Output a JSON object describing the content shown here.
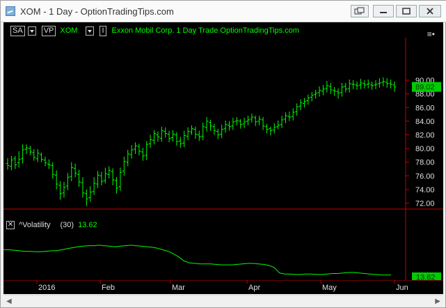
{
  "window": {
    "title": "XOM - 1 Day - OptionTradingTips.com"
  },
  "toolbar": {
    "sa_label": "SA",
    "vp_label": "VP",
    "symbol": "XOM",
    "i_label": "I",
    "description": "Exxon Mobil Corp.  1 Day  Trade  OptionTradingTips.com"
  },
  "indicator": {
    "name": "^Volatility",
    "period": "(30)",
    "value": "13.62"
  },
  "colors": {
    "bars": "#00ff00",
    "price_badge": "#00cc00",
    "volatility_line": "#00ff00",
    "axis_line": "#cc0000",
    "background": "#000000"
  },
  "chart_data": [
    {
      "type": "ohlc",
      "yticks": [
        "72.00",
        "74.00",
        "76.00",
        "78.00",
        "80.00",
        "82.00",
        "84.00",
        "86.00",
        "88.00",
        "90.00"
      ],
      "ylim": [
        70.5,
        91.0
      ],
      "last_price": "89.02",
      "xticks": [
        "2016",
        "Feb",
        "Mar",
        "Apr",
        "May",
        "Jun"
      ],
      "closes": [
        77.5,
        78.3,
        77.6,
        78.4,
        79.8,
        80.1,
        79.5,
        78.7,
        79.3,
        78.4,
        77.9,
        77.6,
        76.2,
        74.8,
        73.4,
        74.3,
        75.8,
        77.2,
        76.4,
        75.1,
        73.5,
        72.6,
        73.6,
        74.9,
        76.1,
        75.2,
        76.3,
        76.8,
        75.4,
        74.2,
        76.5,
        78.1,
        79.2,
        79.8,
        80.4,
        79.6,
        78.9,
        80.6,
        81.3,
        82.2,
        81.7,
        82.6,
        82.2,
        81.5,
        82.1,
        81.0,
        80.7,
        81.9,
        82.5,
        82.9,
        82.1,
        81.7,
        83.2,
        84.0,
        83.3,
        82.6,
        82.0,
        82.8,
        83.5,
        83.2,
        83.9,
        84.1,
        83.5,
        83.9,
        84.2,
        84.6,
        83.9,
        84.3,
        83.3,
        82.8,
        82.6,
        83.1,
        83.4,
        84.2,
        84.8,
        84.6,
        85.3,
        86.1,
        86.7,
        86.9,
        87.4,
        87.8,
        88.1,
        88.5,
        88.7,
        89.2,
        88.6,
        88.4,
        88.1,
        89.0,
        88.7,
        89.5,
        89.4,
        89.2,
        89.6,
        89.3,
        89.5,
        89.2,
        89.4,
        89.6,
        89.8,
        89.5,
        89.4,
        89.0
      ],
      "opens": [
        77.8,
        77.4,
        78.5,
        77.9,
        78.5,
        79.9,
        80.0,
        79.4,
        78.5,
        79.1,
        78.3,
        77.7,
        77.5,
        76.1,
        74.6,
        73.5,
        74.5,
        75.9,
        77.1,
        76.2,
        75.0,
        73.4,
        72.8,
        73.7,
        74.8,
        76.0,
        75.3,
        76.2,
        76.6,
        75.3,
        74.4,
        76.7,
        78.0,
        79.1,
        79.9,
        80.3,
        79.5,
        79.0,
        80.7,
        81.2,
        82.0,
        81.5,
        82.5,
        82.1,
        81.6,
        82.0,
        81.1,
        80.8,
        81.8,
        82.4,
        82.8,
        82.0,
        81.8,
        83.1,
        83.8,
        83.2,
        82.5,
        82.1,
        82.9,
        83.4,
        83.3,
        84.0,
        84.0,
        83.6,
        84.0,
        84.3,
        84.5,
        84.0,
        84.2,
        83.2,
        82.9,
        82.7,
        83.2,
        83.5,
        84.3,
        84.7,
        84.7,
        85.4,
        86.2,
        86.6,
        87.0,
        87.5,
        87.9,
        88.2,
        88.4,
        88.8,
        89.1,
        88.5,
        88.3,
        88.2,
        89.1,
        88.8,
        89.4,
        89.3,
        89.3,
        89.5,
        89.4,
        89.3,
        89.3,
        89.5,
        89.7,
        89.7,
        89.5,
        89.3
      ],
      "highs": [
        78.6,
        78.9,
        78.9,
        79.6,
        80.6,
        80.6,
        80.4,
        79.9,
        79.9,
        79.4,
        78.8,
        78.4,
        78.0,
        76.8,
        75.2,
        75.1,
        76.4,
        78.0,
        77.8,
        76.9,
        75.8,
        74.0,
        74.5,
        75.8,
        76.7,
        76.6,
        77.2,
        77.4,
        77.1,
        75.8,
        77.2,
        78.8,
        79.8,
        80.5,
        80.9,
        80.7,
        80.1,
        81.1,
        82.0,
        82.7,
        82.5,
        83.2,
        83.1,
        82.6,
        82.7,
        82.4,
        81.7,
        82.6,
        83.1,
        83.4,
        83.2,
        82.6,
        83.8,
        84.6,
        84.2,
        83.6,
        82.9,
        83.5,
        84.1,
        84.0,
        84.5,
        84.6,
        84.3,
        84.5,
        84.8,
        85.1,
        84.8,
        84.8,
        84.6,
        83.6,
        83.2,
        83.7,
        84.1,
        84.8,
        85.3,
        85.4,
        85.9,
        86.6,
        87.2,
        87.4,
        87.9,
        88.3,
        88.6,
        89.1,
        89.3,
        89.9,
        89.6,
        89.0,
        88.8,
        89.6,
        89.6,
        90.1,
        90.0,
        89.8,
        90.2,
        90.0,
        90.1,
        89.8,
        90.0,
        90.3,
        90.4,
        90.3,
        90.1,
        89.8
      ],
      "lows": [
        76.9,
        76.8,
        77.0,
        77.2,
        77.8,
        79.2,
        79.0,
        78.2,
        78.0,
        78.0,
        77.4,
        77.0,
        75.6,
        74.0,
        72.5,
        72.8,
        73.9,
        75.2,
        75.8,
        74.4,
        72.8,
        71.6,
        72.2,
        73.2,
        74.2,
        74.6,
        74.9,
        75.6,
        74.6,
        73.4,
        73.8,
        76.0,
        77.4,
        78.5,
        79.2,
        79.0,
        78.2,
        78.3,
        80.1,
        80.6,
        81.0,
        81.0,
        81.6,
        80.9,
        81.0,
        80.4,
        80.1,
        80.2,
        81.2,
        82.0,
        81.4,
        81.1,
        81.2,
        82.5,
        82.6,
        82.0,
        81.4,
        81.5,
        82.3,
        82.6,
        82.7,
        83.4,
        82.9,
        83.0,
        83.4,
        83.8,
        83.3,
        83.4,
        82.7,
        82.2,
        81.9,
        82.2,
        82.8,
        83.0,
        83.7,
        84.0,
        84.1,
        84.8,
        85.6,
        86.0,
        86.4,
        86.9,
        87.3,
        87.6,
        87.8,
        88.2,
        88.0,
        87.7,
        87.3,
        87.6,
        88.2,
        88.2,
        88.7,
        88.6,
        88.7,
        88.8,
        88.8,
        88.6,
        88.7,
        88.9,
        89.1,
        88.9,
        88.8,
        88.3
      ]
    },
    {
      "type": "line",
      "name": "^Volatility",
      "values": [
        28,
        28,
        27.5,
        27,
        26.5,
        26.5,
        26,
        26,
        26.5,
        27,
        27,
        28,
        29,
        30,
        31,
        31.5,
        32,
        32,
        32.5,
        32,
        31.5,
        31,
        31.5,
        32,
        32.5,
        32,
        31.5,
        31,
        30.5,
        29.5,
        28,
        26.5,
        24,
        21,
        17,
        15,
        14.5,
        14,
        14,
        14,
        13.5,
        13,
        13,
        13,
        13.5,
        14,
        14.5,
        14.5,
        14,
        13.5,
        12.5,
        10.5,
        5,
        4,
        4,
        3.5,
        3.5,
        4,
        4,
        3.5,
        3.5,
        4,
        4.5,
        4.5,
        5,
        5.5,
        5.5,
        5,
        4.5,
        4,
        3.5,
        3,
        3,
        3
      ],
      "last_value": "13.62"
    }
  ]
}
